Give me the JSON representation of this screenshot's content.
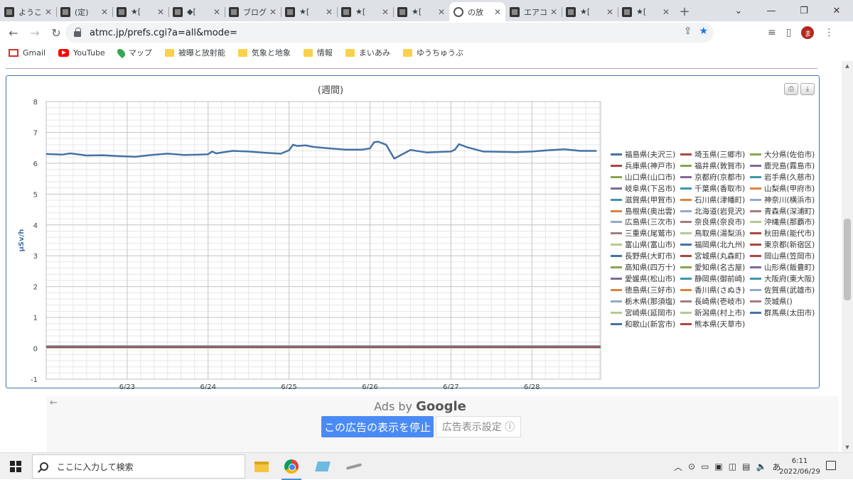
{
  "browser": {
    "tabs": [
      {
        "title": "ようこ",
        "icon": "site-favicon"
      },
      {
        "title": "(定)",
        "icon": "site-favicon"
      },
      {
        "title": "★[",
        "icon": "site-favicon"
      },
      {
        "title": "◆[",
        "icon": "site-favicon"
      },
      {
        "title": "ブログ",
        "icon": "info-favicon"
      },
      {
        "title": "★[",
        "icon": "site-favicon"
      },
      {
        "title": "★[",
        "icon": "site-favicon"
      },
      {
        "title": "★[",
        "icon": "site-favicon"
      },
      {
        "title": "の放",
        "icon": "globe-favicon",
        "active": true
      },
      {
        "title": "エアコ",
        "icon": "site-favicon"
      },
      {
        "title": "★[",
        "icon": "site-favicon"
      },
      {
        "title": "★[",
        "icon": "site-favicon"
      }
    ],
    "url": "atmc.jp/prefs.cgi?a=all&mode=",
    "avatar_letter": "ま",
    "accent": "#1a73e8"
  },
  "bookmarks": [
    {
      "label": "Gmail",
      "icon": "gmail-icon"
    },
    {
      "label": "YouTube",
      "icon": "youtube-icon"
    },
    {
      "label": "マップ",
      "icon": "maps-icon"
    },
    {
      "label": "被曝と放射能",
      "icon": "folder-icon"
    },
    {
      "label": "気象と地象",
      "icon": "folder-icon"
    },
    {
      "label": "情報",
      "icon": "folder-icon"
    },
    {
      "label": "まいあみ",
      "icon": "folder-icon"
    },
    {
      "label": "ゆうちゅうぶ",
      "icon": "folder-icon"
    }
  ],
  "chart_data": {
    "type": "line",
    "title": "(週間)",
    "ylabel": "μSv/h",
    "xlabel": "",
    "ylim": [
      -1,
      8
    ],
    "yticks": [
      -1,
      0,
      1,
      2,
      3,
      4,
      5,
      6,
      7,
      8
    ],
    "xlim": [
      22.0,
      28.85
    ],
    "xticks": [
      {
        "x": 23,
        "label": "6/23"
      },
      {
        "x": 24,
        "label": "6/24"
      },
      {
        "x": 25,
        "label": "6/25"
      },
      {
        "x": 26,
        "label": "6/26"
      },
      {
        "x": 27,
        "label": "6/27"
      },
      {
        "x": 28,
        "label": "6/28"
      }
    ],
    "grid": true,
    "legend_position": "right",
    "series": [
      {
        "name": "福島県(夫沢三)",
        "color": "#4572a7",
        "x": [
          22.0,
          22.2,
          22.3,
          22.5,
          22.7,
          22.9,
          23.1,
          23.3,
          23.5,
          23.7,
          23.9,
          24.0,
          24.05,
          24.1,
          24.3,
          24.5,
          24.7,
          24.9,
          25.0,
          25.05,
          25.1,
          25.2,
          25.3,
          25.5,
          25.7,
          25.9,
          26.0,
          26.05,
          26.1,
          26.2,
          26.3,
          26.5,
          26.7,
          26.9,
          27.0,
          27.05,
          27.1,
          27.2,
          27.4,
          27.6,
          27.8,
          28.0,
          28.2,
          28.4,
          28.6,
          28.8
        ],
        "y": [
          6.3,
          6.28,
          6.32,
          6.25,
          6.26,
          6.23,
          6.21,
          6.27,
          6.31,
          6.27,
          6.28,
          6.29,
          6.38,
          6.32,
          6.4,
          6.38,
          6.34,
          6.31,
          6.42,
          6.6,
          6.56,
          6.58,
          6.53,
          6.48,
          6.44,
          6.44,
          6.48,
          6.68,
          6.7,
          6.6,
          6.15,
          6.43,
          6.35,
          6.37,
          6.38,
          6.44,
          6.62,
          6.52,
          6.38,
          6.37,
          6.36,
          6.38,
          6.42,
          6.45,
          6.4,
          6.4
        ]
      },
      {
        "name": "埼玉県(三郷市)",
        "color": "#aa4643",
        "constant": 0.05
      },
      {
        "name": "大分県(佐伯市)",
        "color": "#89a54e",
        "constant": 0.06
      },
      {
        "name": "兵庫県(神戸市)",
        "color": "#aa4643",
        "constant": 0.06
      },
      {
        "name": "福井県(敦賀市)",
        "color": "#89a54e",
        "constant": 0.04
      },
      {
        "name": "鹿児島(霧島市)",
        "color": "#80699b",
        "constant": 0.07
      },
      {
        "name": "山口県(山口市)",
        "color": "#89a54e",
        "constant": 0.08
      },
      {
        "name": "京都府(京都市)",
        "color": "#80699b",
        "constant": 0.05
      },
      {
        "name": "岩手県(久慈市)",
        "color": "#3d96ae",
        "constant": 0.03
      },
      {
        "name": "岐阜県(下呂市)",
        "color": "#80699b",
        "constant": 0.06
      },
      {
        "name": "千葉県(香取市)",
        "color": "#3d96ae",
        "constant": 0.05
      },
      {
        "name": "山梨県(甲府市)",
        "color": "#db843d",
        "constant": 0.04
      },
      {
        "name": "滋賀県(甲賀市)",
        "color": "#3d96ae",
        "constant": 0.05
      },
      {
        "name": "石川県(津幡町)",
        "color": "#db843d",
        "constant": 0.05
      },
      {
        "name": "神奈川(横浜市)",
        "color": "#92a8cd",
        "constant": 0.04
      },
      {
        "name": "島根県(奥出雲)",
        "color": "#db843d",
        "constant": 0.07
      },
      {
        "name": "北海道(岩見沢)",
        "color": "#92a8cd",
        "constant": 0.03
      },
      {
        "name": "青森県(深浦町)",
        "color": "#a47d7c",
        "constant": 0.03
      },
      {
        "name": "広島県(三次市)",
        "color": "#92a8cd",
        "constant": 0.06
      },
      {
        "name": "奈良県(奈良市)",
        "color": "#a47d7c",
        "constant": 0.05
      },
      {
        "name": "沖縄県(那覇市)",
        "color": "#b5ca92",
        "constant": 0.02
      },
      {
        "name": "三重県(尾鷲市)",
        "color": "#a47d7c",
        "constant": 0.04
      },
      {
        "name": "鳥取県(湯梨浜)",
        "color": "#b5ca92",
        "constant": 0.05
      },
      {
        "name": "秋田県(能代市)",
        "color": "#aa4643",
        "constant": 0.04
      },
      {
        "name": "富山県(富山市)",
        "color": "#b5ca92",
        "constant": 0.05
      },
      {
        "name": "福岡県(北九州)",
        "color": "#4572a7",
        "constant": 0.04
      },
      {
        "name": "東京都(新宿区)",
        "color": "#aa4643",
        "constant": 0.04
      },
      {
        "name": "長野県(大町市)",
        "color": "#4572a7",
        "constant": 0.05
      },
      {
        "name": "宮城県(丸森町)",
        "color": "#aa4643",
        "constant": 0.06
      },
      {
        "name": "岡山県(笠岡市)",
        "color": "#aa4643",
        "constant": 0.05
      },
      {
        "name": "高知県(四万十)",
        "color": "#89a54e",
        "constant": 0.04
      },
      {
        "name": "愛知県(名古屋)",
        "color": "#89a54e",
        "constant": 0.04
      },
      {
        "name": "山形県(飯豊町)",
        "color": "#80699b",
        "constant": 0.05
      },
      {
        "name": "愛媛県(松山市)",
        "color": "#80699b",
        "constant": 0.05
      },
      {
        "name": "静岡県(御前崎)",
        "color": "#3d96ae",
        "constant": 0.04
      },
      {
        "name": "大阪府(東大阪)",
        "color": "#3d96ae",
        "constant": 0.05
      },
      {
        "name": "徳島県(三好市)",
        "color": "#db843d",
        "constant": 0.05
      },
      {
        "name": "香川県(さぬき)",
        "color": "#db843d",
        "constant": 0.05
      },
      {
        "name": "佐賀県(武雄市)",
        "color": "#92a8cd",
        "constant": 0.05
      },
      {
        "name": "栃木県(那須塩)",
        "color": "#92a8cd",
        "constant": 0.08
      },
      {
        "name": "長崎県(壱岐市)",
        "color": "#a47d7c",
        "constant": 0.04
      },
      {
        "name": "茨城県()",
        "color": "#a47d7c",
        "constant": 0.05
      },
      {
        "name": "宮崎県(延岡市)",
        "color": "#b5ca92",
        "constant": 0.05
      },
      {
        "name": "新潟県(村上市)",
        "color": "#b5ca92",
        "constant": 0.05
      },
      {
        "name": "群馬県(太田市)",
        "color": "#4572a7",
        "constant": 0.04
      },
      {
        "name": "和歌山(新宮市)",
        "color": "#4572a7",
        "constant": 0.05
      },
      {
        "name": "熊本県(天草市)",
        "color": "#aa4643",
        "constant": 0.04
      }
    ]
  },
  "ad": {
    "ads_by": "Ads by",
    "google": "Google",
    "stop_label": "この広告の表示を停止",
    "settings_label": "広告表示設定 ⓘ"
  },
  "taskbar": {
    "search_placeholder": "ここに入力して検索",
    "ime": "あ",
    "time": "6:11",
    "date": "2022/06/29"
  }
}
